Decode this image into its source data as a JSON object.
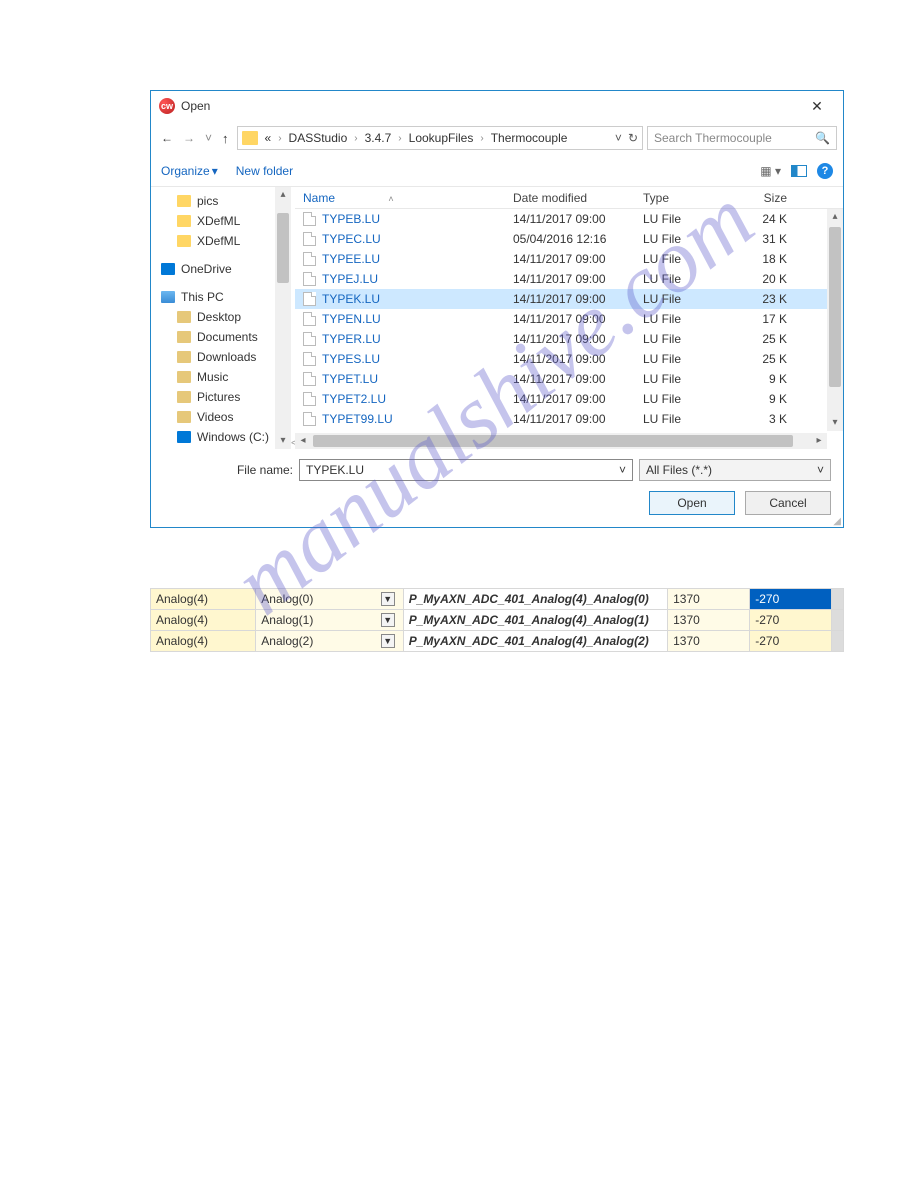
{
  "dialog": {
    "title": "Open",
    "breadcrumb": [
      "«",
      "DASStudio",
      "3.4.7",
      "LookupFiles",
      "Thermocouple"
    ],
    "search_placeholder": "Search Thermocouple",
    "toolbar": {
      "organize": "Organize",
      "new_folder": "New folder"
    },
    "tree": [
      {
        "label": "pics",
        "level": 1,
        "icon": "folder"
      },
      {
        "label": "XDefML",
        "level": 1,
        "icon": "folder"
      },
      {
        "label": "XDefML",
        "level": 1,
        "icon": "folder"
      },
      {
        "label": "OneDrive",
        "level": 0,
        "icon": "drive"
      },
      {
        "label": "This PC",
        "level": 0,
        "icon": "pc"
      },
      {
        "label": "Desktop",
        "level": 1,
        "icon": "lib"
      },
      {
        "label": "Documents",
        "level": 1,
        "icon": "lib"
      },
      {
        "label": "Downloads",
        "level": 1,
        "icon": "lib"
      },
      {
        "label": "Music",
        "level": 1,
        "icon": "lib"
      },
      {
        "label": "Pictures",
        "level": 1,
        "icon": "lib"
      },
      {
        "label": "Videos",
        "level": 1,
        "icon": "lib"
      },
      {
        "label": "Windows (C:)",
        "level": 1,
        "icon": "drive"
      }
    ],
    "columns": {
      "name": "Name",
      "date": "Date modified",
      "type": "Type",
      "size": "Size"
    },
    "files": [
      {
        "name": "TYPEB.LU",
        "date": "14/11/2017 09:00",
        "type": "LU File",
        "size": "24 K",
        "sel": false
      },
      {
        "name": "TYPEC.LU",
        "date": "05/04/2016 12:16",
        "type": "LU File",
        "size": "31 K",
        "sel": false
      },
      {
        "name": "TYPEE.LU",
        "date": "14/11/2017 09:00",
        "type": "LU File",
        "size": "18 K",
        "sel": false
      },
      {
        "name": "TYPEJ.LU",
        "date": "14/11/2017 09:00",
        "type": "LU File",
        "size": "20 K",
        "sel": false
      },
      {
        "name": "TYPEK.LU",
        "date": "14/11/2017 09:00",
        "type": "LU File",
        "size": "23 K",
        "sel": true
      },
      {
        "name": "TYPEN.LU",
        "date": "14/11/2017 09:00",
        "type": "LU File",
        "size": "17 K",
        "sel": false
      },
      {
        "name": "TYPER.LU",
        "date": "14/11/2017 09:00",
        "type": "LU File",
        "size": "25 K",
        "sel": false
      },
      {
        "name": "TYPES.LU",
        "date": "14/11/2017 09:00",
        "type": "LU File",
        "size": "25 K",
        "sel": false
      },
      {
        "name": "TYPET.LU",
        "date": "14/11/2017 09:00",
        "type": "LU File",
        "size": "9 K",
        "sel": false
      },
      {
        "name": "TYPET2.LU",
        "date": "14/11/2017 09:00",
        "type": "LU File",
        "size": "9 K",
        "sel": false
      },
      {
        "name": "TYPET99.LU",
        "date": "14/11/2017 09:00",
        "type": "LU File",
        "size": "3 K",
        "sel": false
      }
    ],
    "file_name_label": "File name:",
    "file_name_value": "TYPEK.LU",
    "filter": "All Files (*.*)",
    "open_btn": "Open",
    "cancel_btn": "Cancel"
  },
  "analog_rows": [
    {
      "a": "Analog(4)",
      "b": "Analog(0)",
      "p": "P_MyAXN_ADC_401_Analog(4)_Analog(0)",
      "v1": "1370",
      "v2": "-270",
      "sel": true
    },
    {
      "a": "Analog(4)",
      "b": "Analog(1)",
      "p": "P_MyAXN_ADC_401_Analog(4)_Analog(1)",
      "v1": "1370",
      "v2": "-270",
      "sel": false
    },
    {
      "a": "Analog(4)",
      "b": "Analog(2)",
      "p": "P_MyAXN_ADC_401_Analog(4)_Analog(2)",
      "v1": "1370",
      "v2": "-270",
      "sel": false
    }
  ],
  "watermark": "manualshive.com"
}
